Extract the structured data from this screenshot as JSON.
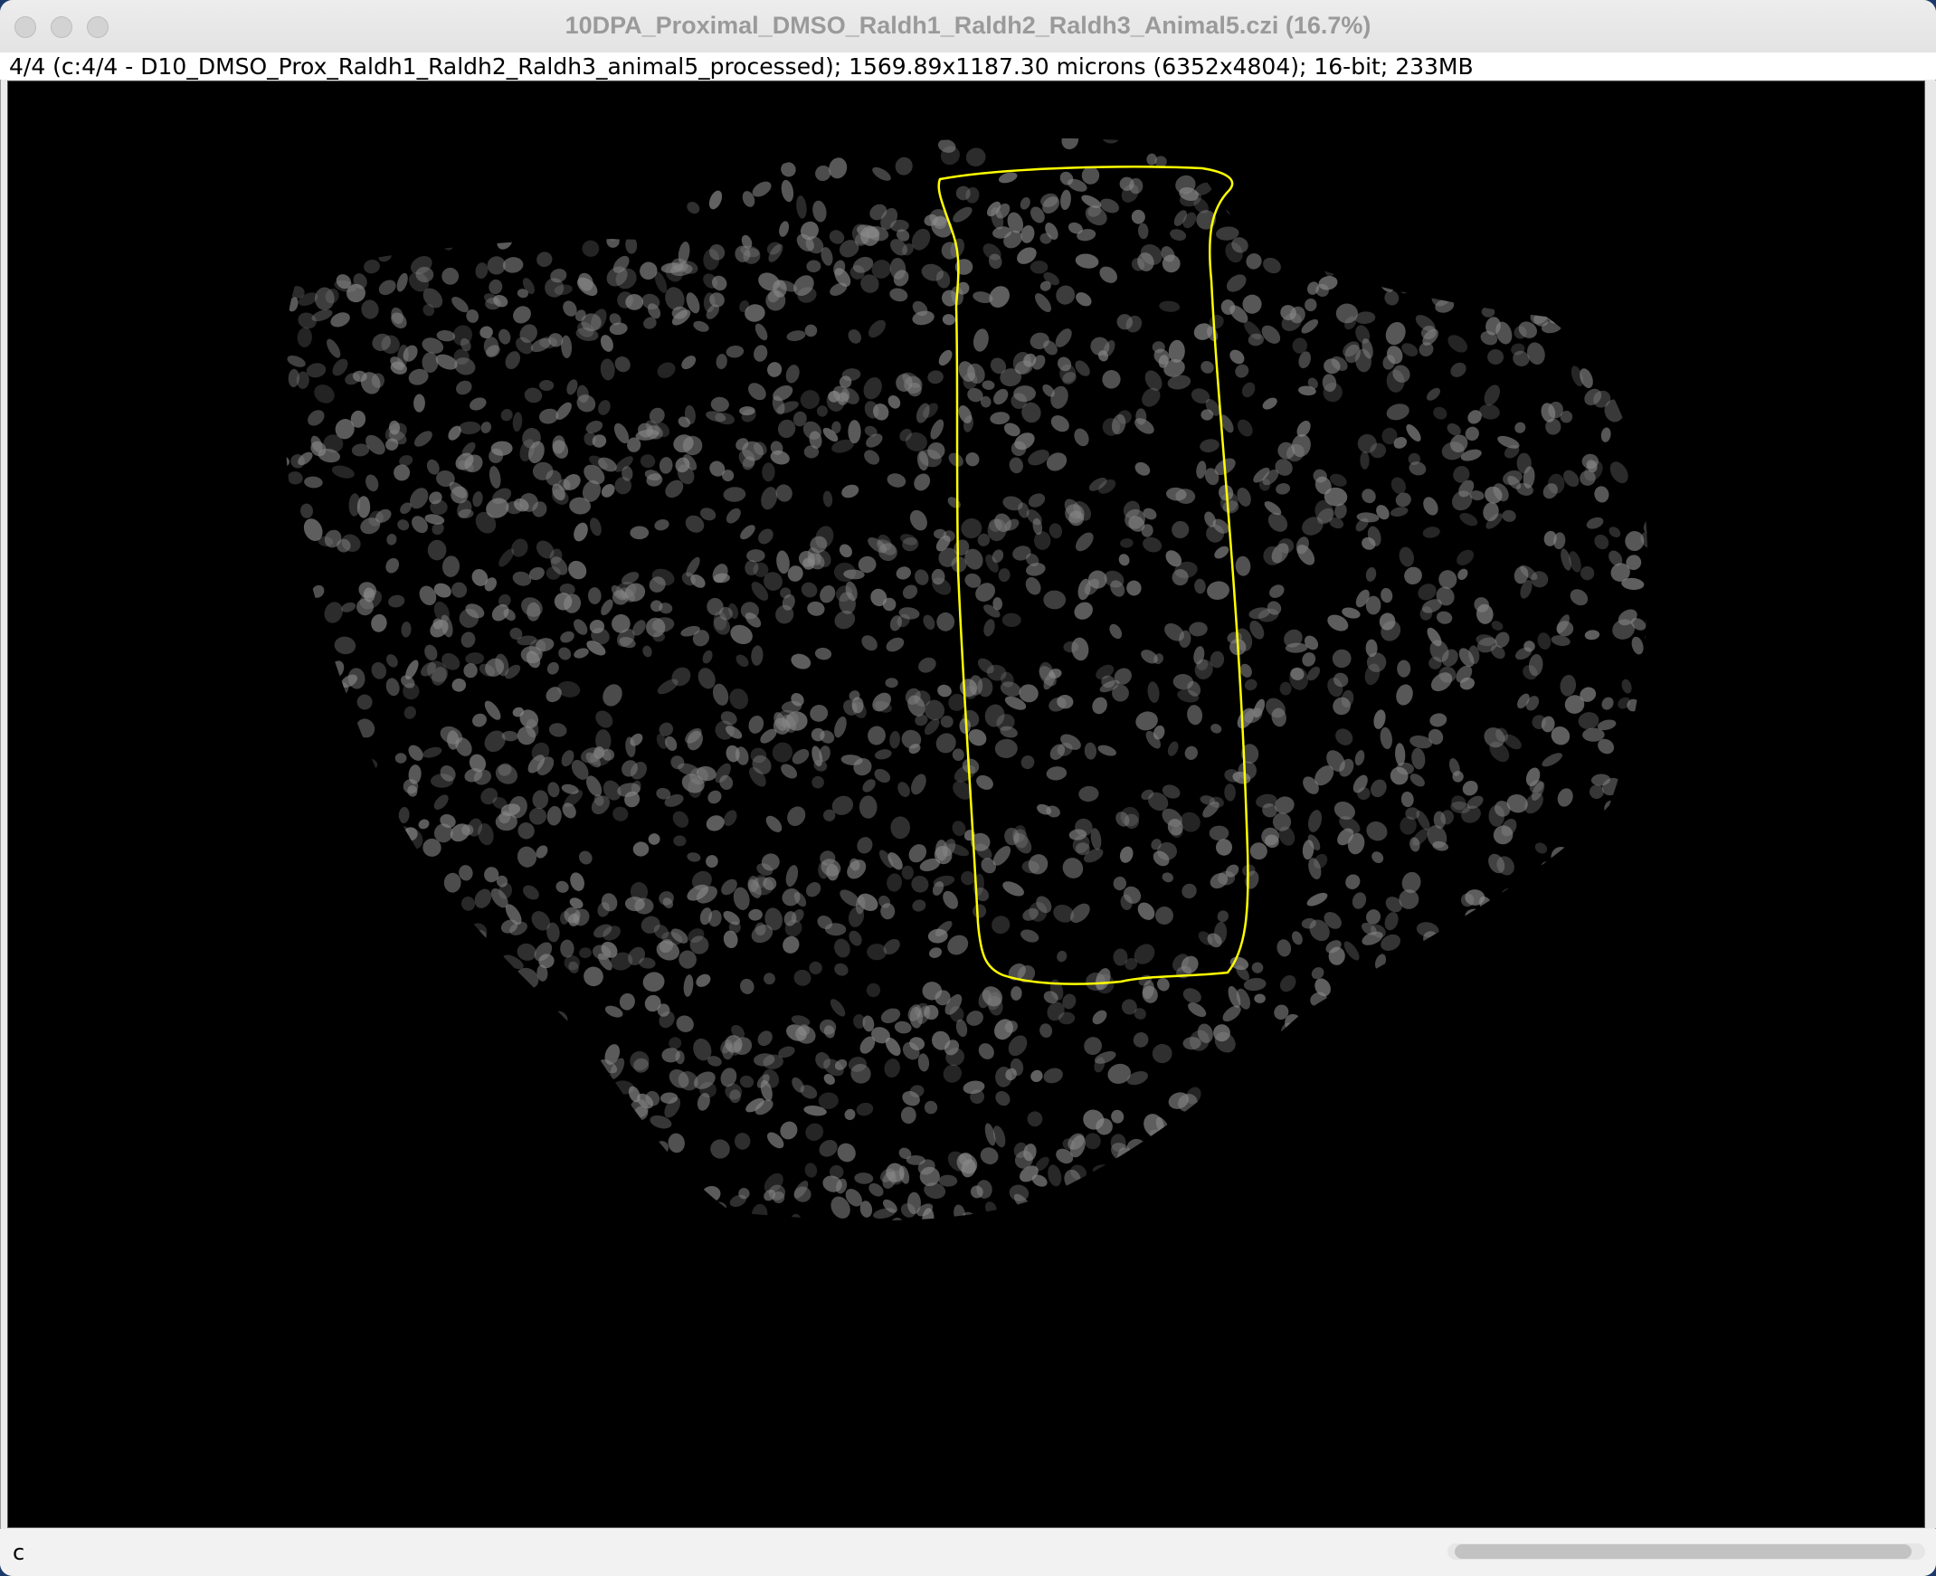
{
  "window": {
    "title": "10DPA_Proximal_DMSO_Raldh1_Raldh2_Raldh3_Animal5.czi (16.7%)"
  },
  "info_bar": {
    "text": "4/4 (c:4/4 - D10_DMSO_Prox_Raldh1_Raldh2_Raldh3_animal5_processed); 1569.89x1187.30 microns (6352x4804); 16-bit; 233MB"
  },
  "status_bar": {
    "text": "c"
  },
  "image": {
    "background_color": "#000000",
    "nuclei_color": "#8a8a8a",
    "roi_color": "#ffff00"
  },
  "icons": {
    "close": "close-traffic-light",
    "minimize": "minimize-traffic-light",
    "zoom": "zoom-traffic-light"
  }
}
